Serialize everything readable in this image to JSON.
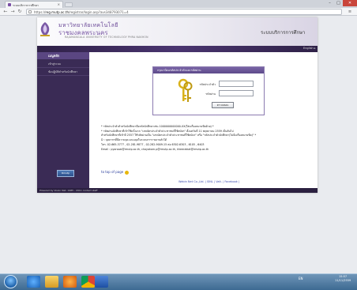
{
  "browser": {
    "tab_title": "ระบบบริการการศึกษา",
    "url_host": "reg.mutp.ac.th",
    "url_path": "/registrar/login.asp?avs348793071=4",
    "url_scheme": "https://",
    "window_controls": [
      "–",
      "□",
      "✕"
    ]
  },
  "header": {
    "university_th_line1": "มหาวิทยาลัยเทคโนโลยี",
    "university_th_line2": "ราชมงคลพระนคร",
    "university_en": "RAJAMANGALA UNIVERSITY OF TECHNOLOGY PHRA NAKHON",
    "service_title": "ระบบบริการการศึกษา",
    "lang_link": "English ▸"
  },
  "sidebar": {
    "heading": "เมนูหลัก",
    "items": [
      {
        "label": "เข้าสู่ระบบ"
      },
      {
        "label": "ข้อปฏิบัติสำหรับนักศึกษา"
      }
    ],
    "badge": "Rmutp"
  },
  "login": {
    "heading": "กรุณาป้อนรหัสประจำตัวและรหัสผ่าน",
    "username_label": "รหัสประจำตัว",
    "password_label": "รหัสผ่าน",
    "username_value": "",
    "password_value": "",
    "submit_label": "ตรวจสอบ"
  },
  "info_lines": [
    "* รหัสประจำตัวสำหรับนักศึกษาคือรหัสนักศึกษาเช่น 1000000000000-XX(ใส่เครื่องหมายขีดด้วย) *",
    "* รหัสผ่านนักศึกษาที่เข้าใช้ครั้งแรก \"เลขบัตรประจำตัวประชาชนที่ใช้สมัคร\" ตั้งแต่วันที่ 11 พฤษภาคม 2559 เป็นต้นไป",
    "สำหรับนักศึกษาที่เข้าปี 2557 ใช้รหัสผ่านเป็น \"เลขบัตรประจำตัวประชาชนที่ใช้สมัคร\" หรือ \"รหัสประจำตัวนักศึกษา(ไม่มีเครื่องหมายขีด)\" *",
    "D : บุคลากรที่มีความจุคะแนนจุดในระบบการรายงานตัวได้",
    "โทร. 02-665-3777 , 02-281-9877 , 02-282-9009-15 ต่อ 6302-6303 , 6105 , 6403",
    "Email : pyorsaai@rmutp.ac.th, chayakorn.p@rmutp.ac.th, kheerakiat@rmutp.ac.th"
  ],
  "top_of_page": "to top of page",
  "footer_links": "Webin Net Co.,Ltd. | SINL | Valt. | Facebook |",
  "footer_text": "Powered by Vision Net. 1985 - 2011      contact staff",
  "taskbar": {
    "apps": [
      "ie-icon",
      "folder-icon",
      "media-icon",
      "chrome-icon",
      "word-icon"
    ],
    "tray_lang": "EN",
    "clock_time": "15:57",
    "clock_date": "11/11/2559"
  },
  "colors": {
    "brand_purple": "#3a2b55",
    "header_purple": "#6c4b99",
    "taskbar_blue": "#3d6a92"
  }
}
